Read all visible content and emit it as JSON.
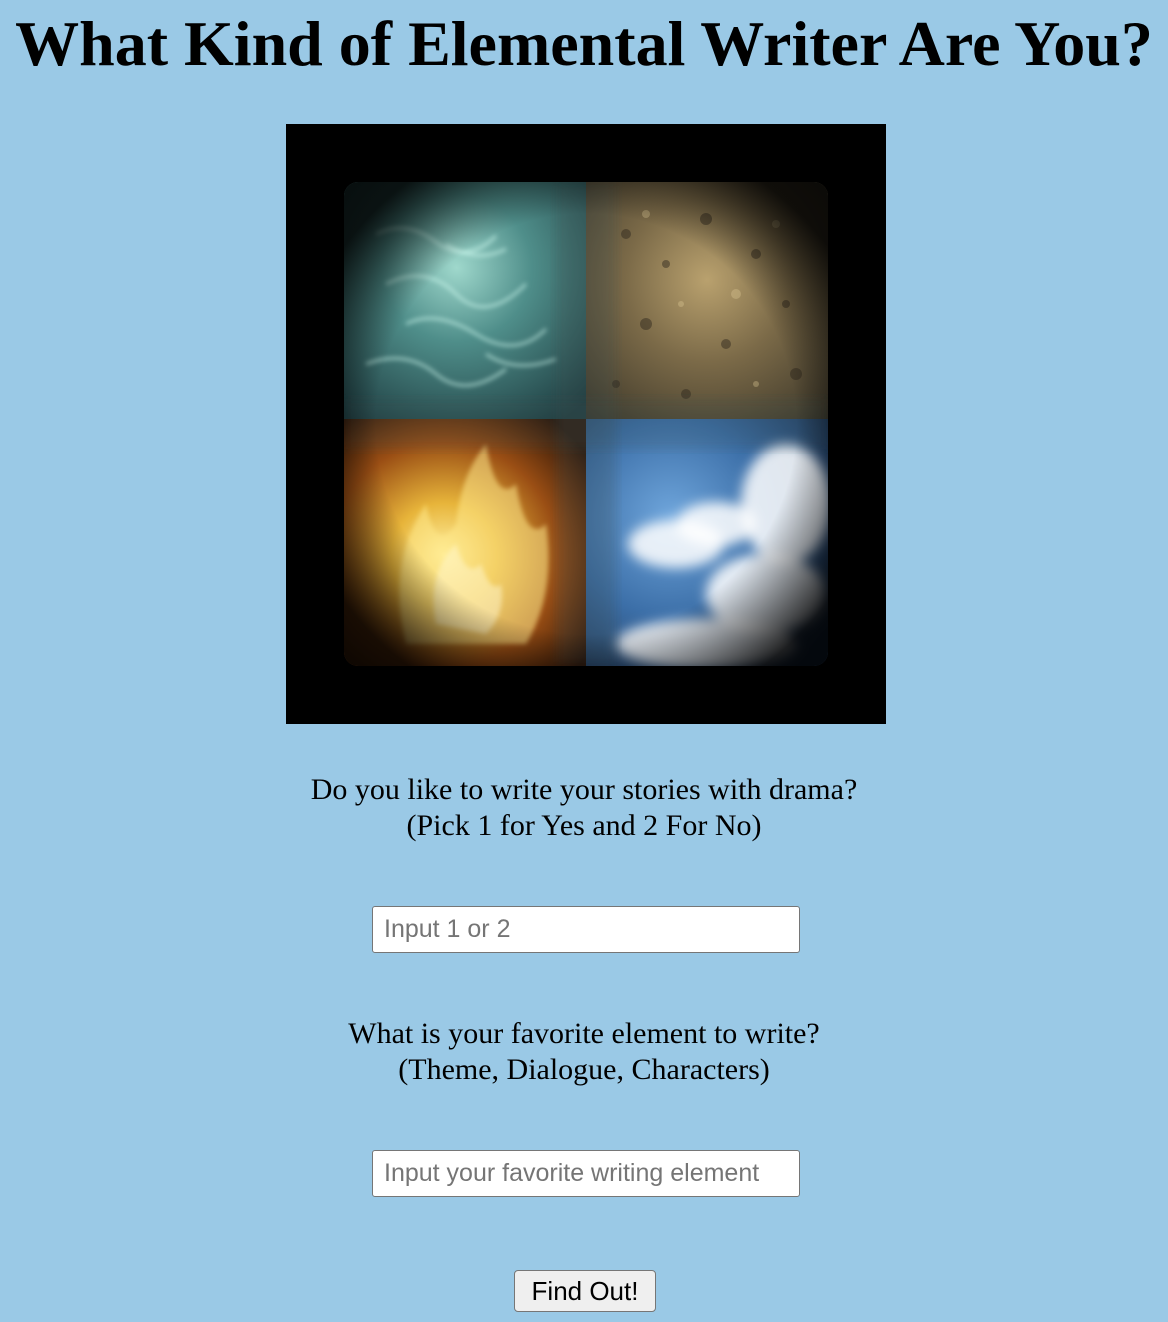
{
  "page": {
    "title": "What Kind of Elemental Writer Are You?",
    "background_color": "#9ac9e6"
  },
  "hero_image": {
    "description_name": "four-elements-image",
    "quadrants": [
      "water",
      "earth",
      "fire",
      "air"
    ]
  },
  "questions": [
    {
      "line1": "Do you like to write your stories with drama?",
      "line2": "(Pick 1 for Yes and 2 For No)",
      "input_placeholder": "Input 1 or 2",
      "input_value": ""
    },
    {
      "line1": "What is your favorite element to write?",
      "line2": "(Theme, Dialogue, Characters)",
      "input_placeholder": "Input your favorite writing element",
      "input_value": ""
    }
  ],
  "submit": {
    "label": "Find Out!"
  }
}
